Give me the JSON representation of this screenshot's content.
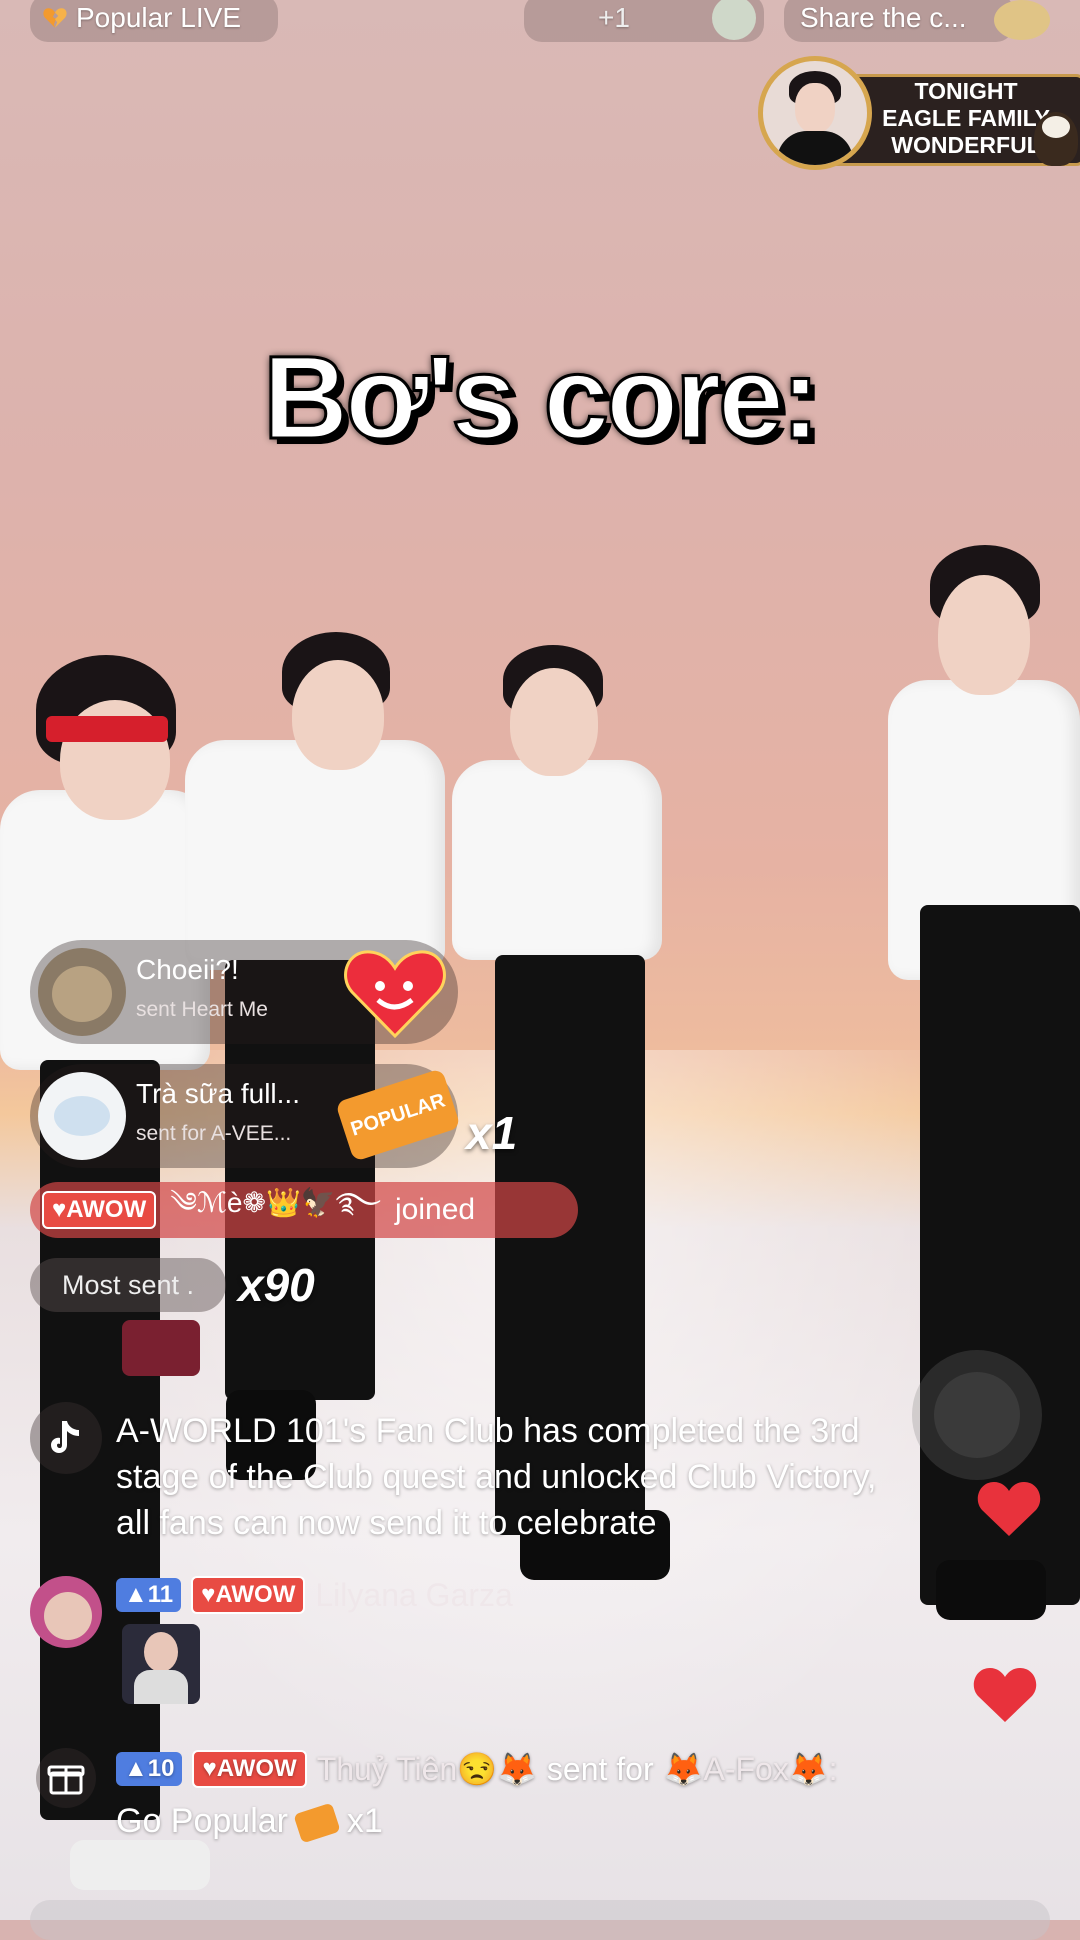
{
  "top_bar": {
    "popular_live_label": "Popular LIVE",
    "viewer_increment": "+1",
    "share_label": "Share the c..."
  },
  "banner": {
    "line1": "TONIGHT",
    "line2": "EAGLE FAMILY",
    "line3": "WONDERFUL"
  },
  "caption": "Bơ's core:",
  "gifts": [
    {
      "name": "Choeii?!",
      "subtitle": "sent Heart Me"
    },
    {
      "name": "Trà sữa full...",
      "subtitle": "sent for A-VEE...",
      "combo": "x1",
      "sticker_text": "POPULAR"
    }
  ],
  "join_event": {
    "badge": "AWOW",
    "username": "༄ℳè❁👑🦅࿐",
    "action": "joined"
  },
  "most_sent": {
    "label": "Most sent .",
    "combo": "x90"
  },
  "system_message": {
    "text_line1": "A-WORLD 101's Fan Club has completed the 3rd",
    "text_line2": "stage of the Club quest and unlocked Club Victory,",
    "text_line3": "all fans can now send it to celebrate"
  },
  "comments": [
    {
      "level": "11",
      "badge": "AWOW",
      "username": "Lilyana Garza"
    },
    {
      "level": "10",
      "badge": "AWOW",
      "username": "Thuỷ Tiên😒🦊",
      "action": "sent for",
      "target": "🦊A-Fox🦊:",
      "line2_gift": "Go Popular",
      "line2_combo": "x1"
    }
  ],
  "colors": {
    "awow_badge": "#e84b43",
    "level_badge": "#4f7de0",
    "like_heart": "#e8323c"
  }
}
